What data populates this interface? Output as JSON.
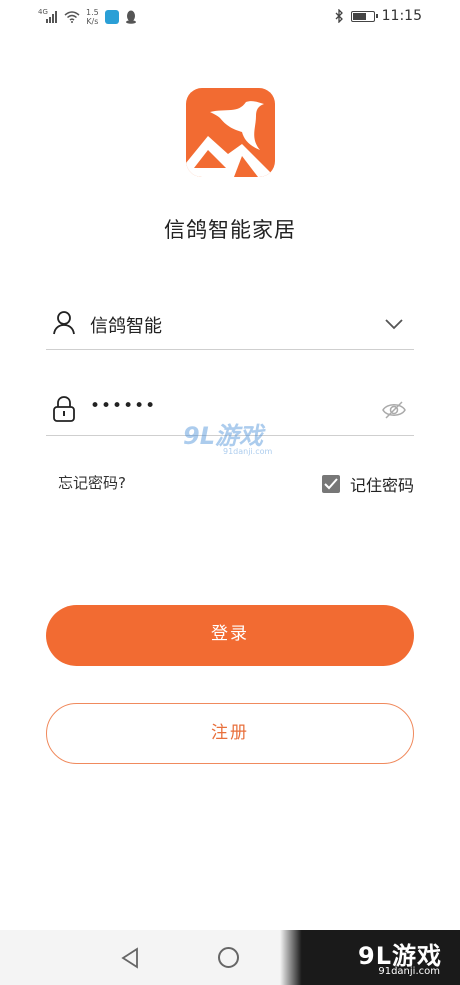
{
  "status_bar": {
    "network_label": "4G",
    "speed_value": "1.5",
    "speed_unit": "K/s",
    "time": "11:15",
    "battery_level": 0.7
  },
  "app": {
    "title": "信鸽智能家居",
    "brand_color": "#f26b32"
  },
  "login": {
    "username": "信鸽智能",
    "password_masked": "••••••",
    "forgot_password": "忘记密码?",
    "remember_password": "记住密码",
    "remember_checked": true,
    "login_button": "登录",
    "register_button": "注册"
  },
  "watermark": {
    "main": "9L游戏",
    "sub": "91danji.com"
  },
  "corner_watermark": {
    "main": "9L游戏",
    "sub": "91danji.com"
  }
}
